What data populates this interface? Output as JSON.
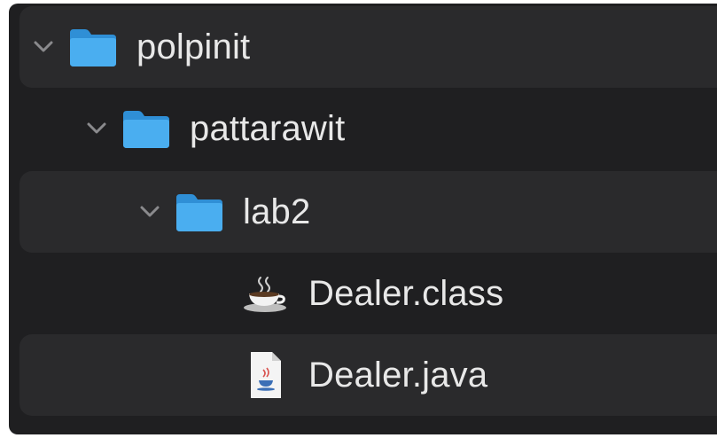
{
  "tree": {
    "items": [
      {
        "label": "polpinit",
        "icon": "folder-icon",
        "expanded": true
      },
      {
        "label": "pattarawit",
        "icon": "folder-icon",
        "expanded": true
      },
      {
        "label": "lab2",
        "icon": "folder-icon",
        "expanded": true
      },
      {
        "label": "Dealer.class",
        "icon": "java-class-coffee-icon"
      },
      {
        "label": "Dealer.java",
        "icon": "java-source-file-icon"
      }
    ]
  },
  "colors": {
    "background": "#1f1f21",
    "row_alt": "#2a2a2c",
    "folder": "#41a7ea",
    "text": "#e8e8e8"
  }
}
